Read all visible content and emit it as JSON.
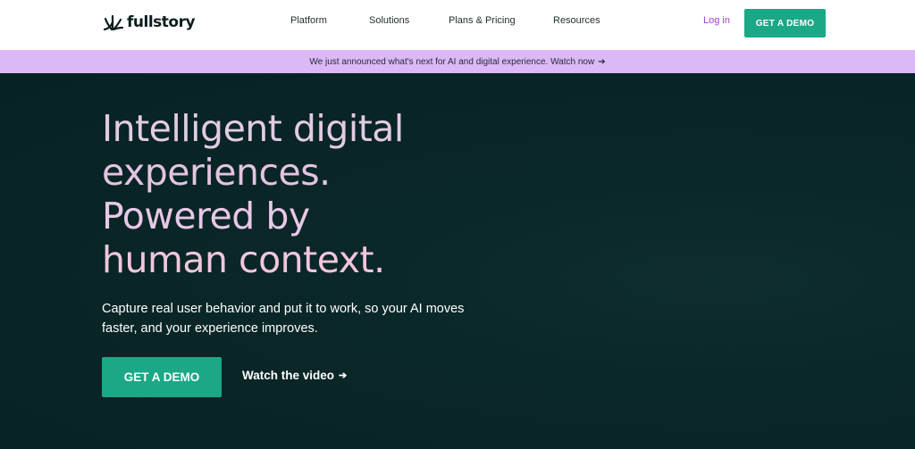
{
  "brand": {
    "name": "fullstory",
    "accent": "#1ba886",
    "announce_bg": "#dcb8f7",
    "hero_bg": "#072222",
    "login_color": "#a33fcf"
  },
  "nav": {
    "items": [
      {
        "label": "Platform"
      },
      {
        "label": "Solutions"
      },
      {
        "label": "Plans & Pricing"
      },
      {
        "label": "Resources"
      }
    ],
    "login": "Log in",
    "demo": "GET A DEMO"
  },
  "announcement": {
    "text": "We just announced what's next for AI and digital experience. Watch now",
    "icon": "arrow-right-icon"
  },
  "hero": {
    "headline": [
      "Intelligent digital",
      "experiences.",
      "Powered by",
      "human context."
    ],
    "subtext": "Capture real user behavior and put it to work, so your AI moves faster, and your experience improves.",
    "cta_primary": "GET A DEMO",
    "cta_secondary": "Watch the video"
  }
}
